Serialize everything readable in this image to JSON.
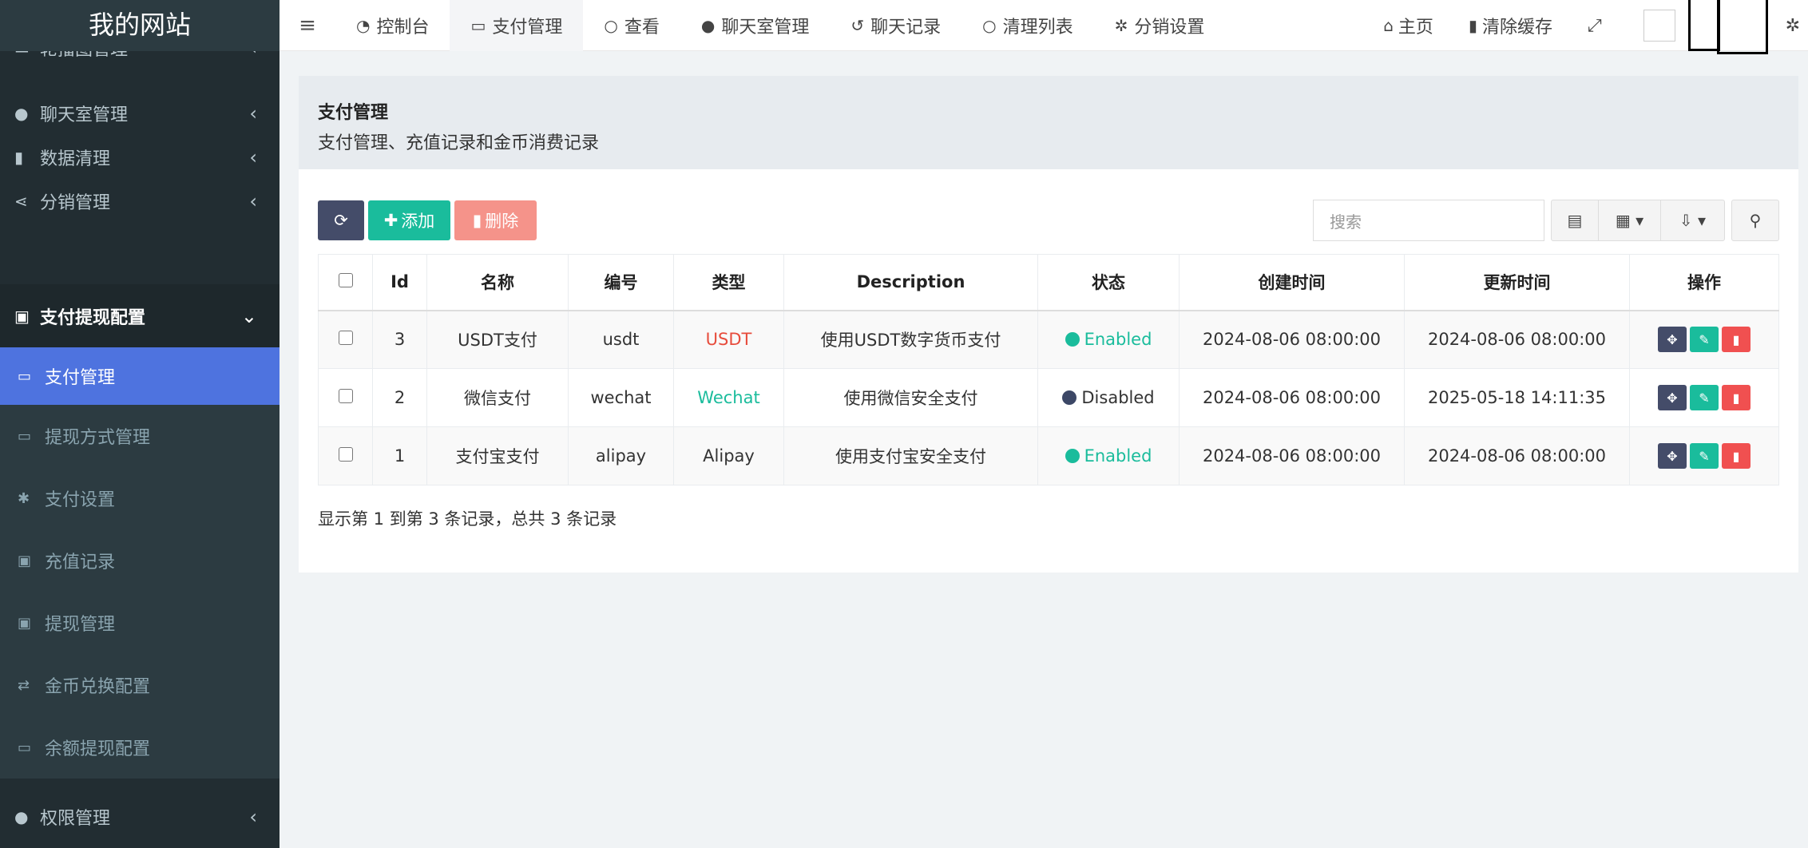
{
  "sidebar": {
    "logo": "我的网站",
    "partial_item": "轮播图管理",
    "items_top": [
      {
        "label": "聊天室管理",
        "icon": "comments-icon"
      },
      {
        "label": "数据清理",
        "icon": "trash-icon"
      },
      {
        "label": "分销管理",
        "icon": "share-icon"
      }
    ],
    "open_item": {
      "label": "支付提现配置",
      "icon": "money-icon"
    },
    "sub_items": [
      {
        "label": "支付管理",
        "icon": "credit-card-icon",
        "active": true
      },
      {
        "label": "提现方式管理",
        "icon": "credit-card-icon"
      },
      {
        "label": "支付设置",
        "icon": "gear-icon"
      },
      {
        "label": "充值记录",
        "icon": "money-icon"
      },
      {
        "label": "提现管理",
        "icon": "money-icon"
      },
      {
        "label": "金币兑换配置",
        "icon": "exchange-icon"
      },
      {
        "label": "余额提现配置",
        "icon": "credit-card-icon"
      }
    ],
    "bottom_item": {
      "label": "权限管理",
      "icon": "users-icon"
    }
  },
  "topbar": {
    "tabs": [
      {
        "label": "控制台",
        "icon": "dashboard-icon"
      },
      {
        "label": "支付管理",
        "icon": "credit-card-icon",
        "active": true
      },
      {
        "label": "查看",
        "icon": "circle-icon"
      },
      {
        "label": "聊天室管理",
        "icon": "comment-icon"
      },
      {
        "label": "聊天记录",
        "icon": "history-icon"
      },
      {
        "label": "清理列表",
        "icon": "circle-icon"
      },
      {
        "label": "分销设置",
        "icon": "gears-icon"
      }
    ],
    "home_label": "主页",
    "clear_cache_label": "清除缓存"
  },
  "page": {
    "title": "支付管理",
    "subtitle": "支付管理、充值记录和金币消费记录"
  },
  "toolbar": {
    "add_label": "添加",
    "delete_label": "删除",
    "search_placeholder": "搜索"
  },
  "table": {
    "headers": [
      "Id",
      "名称",
      "编号",
      "类型",
      "Description",
      "状态",
      "创建时间",
      "更新时间",
      "操作"
    ],
    "rows": [
      {
        "id": "3",
        "name": "USDT支付",
        "code": "usdt",
        "type": "USDT",
        "type_color": "#e74c3c",
        "desc": "使用USDT数字货币支付",
        "status": "Enabled",
        "status_color": "#1abc9c",
        "status_text_color": "#1abc9c",
        "created": "2024-08-06 08:00:00",
        "updated": "2024-08-06 08:00:00"
      },
      {
        "id": "2",
        "name": "微信支付",
        "code": "wechat",
        "type": "Wechat",
        "type_color": "#1abc9c",
        "desc": "使用微信安全支付",
        "status": "Disabled",
        "status_color": "#3c4766",
        "status_text_color": "#333333",
        "created": "2024-08-06 08:00:00",
        "updated": "2025-05-18 14:11:35"
      },
      {
        "id": "1",
        "name": "支付宝支付",
        "code": "alipay",
        "type": "Alipay",
        "type_color": "#333333",
        "desc": "使用支付宝安全支付",
        "status": "Enabled",
        "status_color": "#1abc9c",
        "status_text_color": "#1abc9c",
        "created": "2024-08-06 08:00:00",
        "updated": "2024-08-06 08:00:00"
      }
    ]
  },
  "footer": {
    "summary": "显示第 1 到第 3 条记录，总共 3 条记录"
  },
  "colors": {
    "sidebar_bg": "#222d32",
    "active_blue": "#4e73df",
    "green": "#1abc9c",
    "red": "#f05050",
    "dark": "#444c69"
  }
}
